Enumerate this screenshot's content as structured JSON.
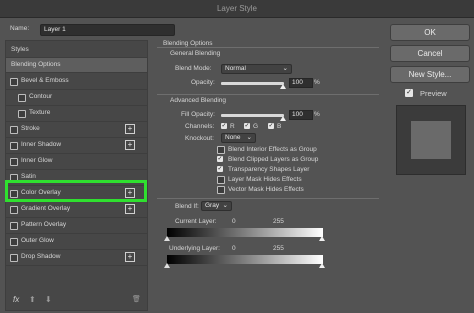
{
  "window": {
    "title": "Layer Style"
  },
  "name_field": {
    "label": "Name:",
    "value": "Layer 1"
  },
  "left_panel": {
    "header": "Styles",
    "items": [
      {
        "label": "Blending Options",
        "checkbox": false,
        "plus": false,
        "selected": true,
        "indent": false
      },
      {
        "label": "Bevel & Emboss",
        "checkbox": true,
        "plus": false,
        "indent": false
      },
      {
        "label": "Contour",
        "checkbox": true,
        "plus": false,
        "indent": true
      },
      {
        "label": "Texture",
        "checkbox": true,
        "plus": false,
        "indent": true
      },
      {
        "label": "Stroke",
        "checkbox": true,
        "plus": true,
        "indent": false
      },
      {
        "label": "Inner Shadow",
        "checkbox": true,
        "plus": true,
        "indent": false
      },
      {
        "label": "Inner Glow",
        "checkbox": true,
        "plus": false,
        "indent": false
      },
      {
        "label": "Satin",
        "checkbox": true,
        "plus": false,
        "indent": false
      },
      {
        "label": "Color Overlay",
        "checkbox": true,
        "plus": true,
        "indent": false,
        "highlighted": true
      },
      {
        "label": "Gradient Overlay",
        "checkbox": true,
        "plus": true,
        "indent": false
      },
      {
        "label": "Pattern Overlay",
        "checkbox": true,
        "plus": false,
        "indent": false
      },
      {
        "label": "Outer Glow",
        "checkbox": true,
        "plus": false,
        "indent": false
      },
      {
        "label": "Drop Shadow",
        "checkbox": true,
        "plus": true,
        "indent": false
      }
    ],
    "bottom": {
      "fx": "fx",
      "up": "⬆",
      "down": "⬇",
      "trash": "🗑"
    }
  },
  "blending": {
    "title": "Blending Options",
    "general": {
      "title": "General Blending",
      "blend_mode_label": "Blend Mode:",
      "blend_mode_value": "Normal",
      "opacity_label": "Opacity:",
      "opacity_value": "100",
      "percent": "%"
    },
    "advanced": {
      "title": "Advanced Blending",
      "fill_opacity_label": "Fill Opacity:",
      "fill_opacity_value": "100",
      "percent": "%",
      "channels_label": "Channels:",
      "channels": [
        "R",
        "G",
        "B"
      ],
      "knockout_label": "Knockout:",
      "knockout_value": "None",
      "options": [
        {
          "label": "Blend Interior Effects as Group",
          "checked": false
        },
        {
          "label": "Blend Clipped Layers as Group",
          "checked": true
        },
        {
          "label": "Transparency Shapes Layer",
          "checked": true
        },
        {
          "label": "Layer Mask Hides Effects",
          "checked": false
        },
        {
          "label": "Vector Mask Hides Effects",
          "checked": false
        }
      ]
    },
    "blend_if": {
      "label": "Blend If:",
      "value": "Gray",
      "current_layer_label": "Current Layer:",
      "current_min": "0",
      "current_max": "255",
      "underlying_layer_label": "Underlying Layer:",
      "underlying_min": "0",
      "underlying_max": "255"
    }
  },
  "buttons": {
    "ok": "OK",
    "cancel": "Cancel",
    "new_style": "New Style..."
  },
  "preview": {
    "label": "Preview",
    "checked": true
  },
  "colors": {
    "highlight": "#2fe02f",
    "panel": "#474747",
    "dialog": "#535353"
  }
}
